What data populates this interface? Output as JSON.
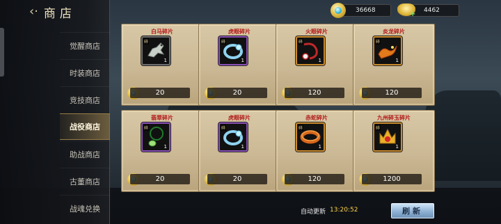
{
  "header": {
    "back_icon": "back-arrow-icon",
    "title": "商店"
  },
  "sidebar": {
    "items": [
      {
        "label": "觉醒商店",
        "active": false
      },
      {
        "label": "时装商店",
        "active": false
      },
      {
        "label": "竞技商店",
        "active": false
      },
      {
        "label": "战役商店",
        "active": true
      },
      {
        "label": "助战商店",
        "active": false
      },
      {
        "label": "古董商店",
        "active": false
      },
      {
        "label": "战魂兑换",
        "active": false
      }
    ]
  },
  "currencies": [
    {
      "icon": "gem-coin-icon",
      "value": "36668"
    },
    {
      "icon": "gold-ingot-icon",
      "value": "4462",
      "add_icon": "plus-icon"
    }
  ],
  "items": [
    {
      "name": "白马碎片",
      "count": "1",
      "price": "20",
      "icon": "silver-horse-icon"
    },
    {
      "name": "虎眼碎片",
      "count": "1",
      "price": "20",
      "icon": "blue-ring-icon"
    },
    {
      "name": "火眼碎片",
      "count": "1",
      "price": "120",
      "icon": "red-chain-icon"
    },
    {
      "name": "炎龙碎片",
      "count": "1",
      "price": "120",
      "icon": "fire-dragon-icon"
    },
    {
      "name": "翡翠碎片",
      "count": "1",
      "price": "20",
      "icon": "jade-pendant-icon"
    },
    {
      "name": "虎眼碎片",
      "count": "1",
      "price": "20",
      "icon": "blue-ring-icon"
    },
    {
      "name": "赤蛇碎片",
      "count": "1",
      "price": "120",
      "icon": "orange-bracelet-icon"
    },
    {
      "name": "九州碎玉碎片",
      "count": "1",
      "price": "1200",
      "icon": "golden-crown-icon"
    }
  ],
  "badge_text": "碎",
  "footer": {
    "refresh_label": "自动更新",
    "refresh_time": "13:20:52",
    "refresh_button": "刷新"
  }
}
